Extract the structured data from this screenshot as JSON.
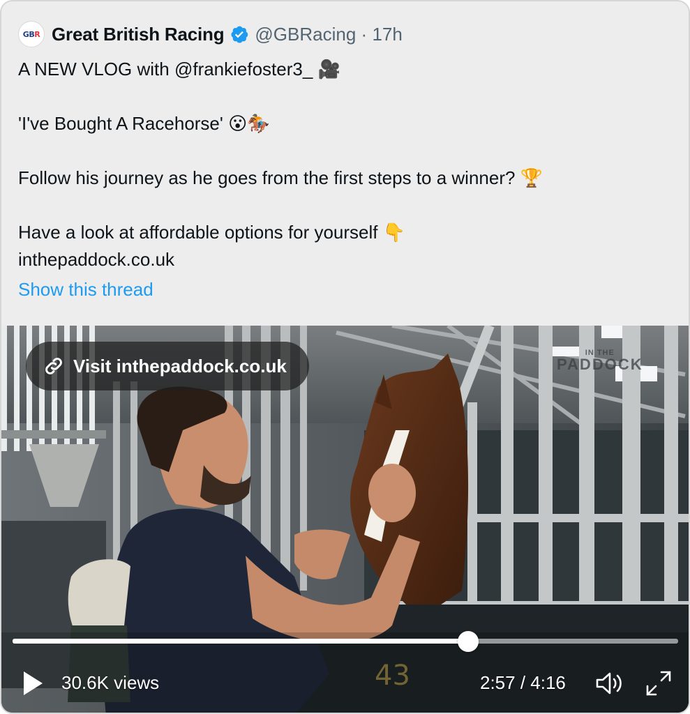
{
  "tweet": {
    "author_name": "Great British Racing",
    "handle": "@GBRacing",
    "separator": "·",
    "time": "17h",
    "avatar_text_main": "GB",
    "avatar_text_accent": "R",
    "verified": true,
    "lines": [
      "A NEW VLOG with @frankiefoster3_ 🎥",
      "",
      "'I've Bought A Racehorse' 😮🏇",
      "",
      "Follow his journey as he goes from the first steps to a winner? 🏆",
      "",
      "Have a look at affordable options for yourself 👇",
      "inthepaddock.co.uk"
    ],
    "show_thread": "Show this thread"
  },
  "video": {
    "visit_link": "Visit inthepaddock.co.uk",
    "watermark_small": "IN THE",
    "watermark_big": "PADDOCK",
    "views": "30.6K views",
    "current_time": "2:57",
    "duration": "4:16",
    "time_separator": " / ",
    "progress": 0.685,
    "stall_number": "43"
  },
  "colors": {
    "link_blue": "#1d9bf0",
    "verified_blue": "#1d9bf0",
    "card_bg": "#ededed"
  },
  "icons": [
    "verified-badge-icon",
    "link-icon",
    "play-icon",
    "volume-icon",
    "fullscreen-icon"
  ]
}
